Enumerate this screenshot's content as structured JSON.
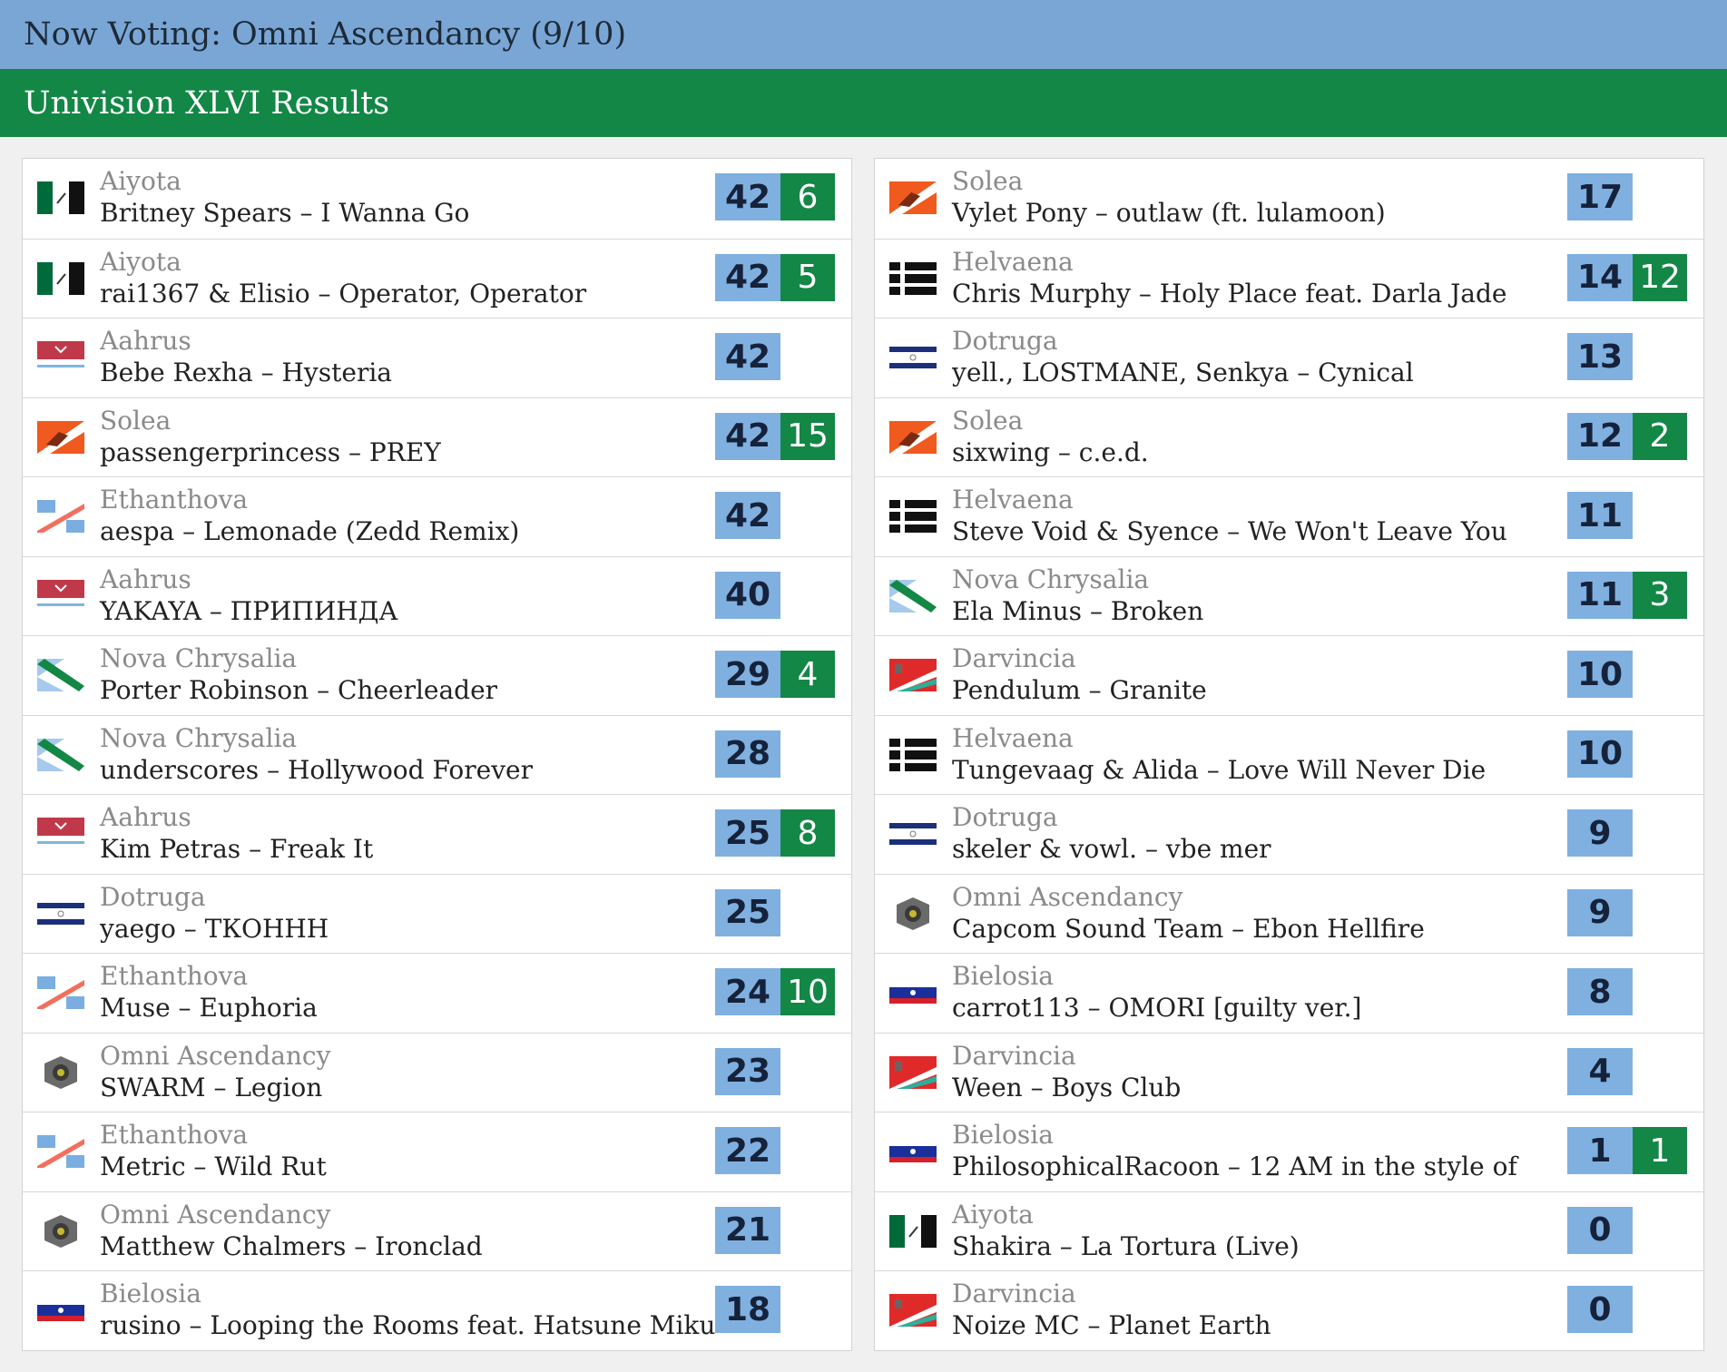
{
  "header": {
    "now_voting": "Now Voting: Omni Ascendancy (9/10)",
    "results_title": "Univision XLVI Results"
  },
  "flag_colors": {
    "aiyota": [
      "#006b3a",
      "#ffffff",
      "#111111"
    ],
    "aahrus": [
      "#c0394b",
      "#ffffff",
      "#7fb6e0"
    ],
    "solea": [
      "#f05a1e",
      "#ffffff",
      "#7a2a10"
    ],
    "ethanthova": [
      "#7aaee0",
      "#ffffff",
      "#f07060"
    ],
    "nova_chrysalia": [
      "#7fb4e6",
      "#ffffff",
      "#138746"
    ],
    "dotruga": [
      "#1b2f7a",
      "#ffffff"
    ],
    "omni_ascendancy": [
      "#6a6a6a",
      "#c8b830",
      "#3a3a3a"
    ],
    "bielosia": [
      "#ffffff",
      "#1a2f9a",
      "#d4202a"
    ],
    "helvaena": [
      "#111111",
      "#ffffff"
    ],
    "darvincia": [
      "#e02a2a",
      "#ffffff",
      "#2ab09a"
    ]
  },
  "results_left": [
    {
      "flag": "aiyota-flag-icon",
      "country": "Aiyota",
      "song": "Britney Spears – I Wanna Go",
      "points": "42",
      "jury": "6"
    },
    {
      "flag": "aiyota-flag-icon",
      "country": "Aiyota",
      "song": "rai1367 & Elisio – Operator, Operator",
      "points": "42",
      "jury": "5"
    },
    {
      "flag": "aahrus-flag-icon",
      "country": "Aahrus",
      "song": "Bebe Rexha – Hysteria",
      "points": "42",
      "jury": ""
    },
    {
      "flag": "solea-flag-icon",
      "country": "Solea",
      "song": "passengerprincess – PREY",
      "points": "42",
      "jury": "15"
    },
    {
      "flag": "ethanthova-flag-icon",
      "country": "Ethanthova",
      "song": "aespa – Lemonade (Zedd Remix)",
      "points": "42",
      "jury": ""
    },
    {
      "flag": "aahrus-flag-icon",
      "country": "Aahrus",
      "song": "YAKAYA – ПРИПИНДА",
      "points": "40",
      "jury": ""
    },
    {
      "flag": "nova-chrysalia-flag-icon",
      "country": "Nova Chrysalia",
      "song": "Porter Robinson – Cheerleader",
      "points": "29",
      "jury": "4"
    },
    {
      "flag": "nova-chrysalia-flag-icon",
      "country": "Nova Chrysalia",
      "song": "underscores – Hollywood Forever",
      "points": "28",
      "jury": ""
    },
    {
      "flag": "aahrus-flag-icon",
      "country": "Aahrus",
      "song": "Kim Petras – Freak It",
      "points": "25",
      "jury": "8"
    },
    {
      "flag": "dotruga-flag-icon",
      "country": "Dotruga",
      "song": "yaego – ТКОННН",
      "points": "25",
      "jury": ""
    },
    {
      "flag": "ethanthova-flag-icon",
      "country": "Ethanthova",
      "song": "Muse – Euphoria",
      "points": "24",
      "jury": "10"
    },
    {
      "flag": "omni-ascendancy-flag-icon",
      "country": "Omni Ascendancy",
      "song": "SWARM – Legion",
      "points": "23",
      "jury": ""
    },
    {
      "flag": "ethanthova-flag-icon",
      "country": "Ethanthova",
      "song": "Metric – Wild Rut",
      "points": "22",
      "jury": ""
    },
    {
      "flag": "omni-ascendancy-flag-icon",
      "country": "Omni Ascendancy",
      "song": "Matthew Chalmers – Ironclad",
      "points": "21",
      "jury": ""
    },
    {
      "flag": "bielosia-flag-icon",
      "country": "Bielosia",
      "song": "rusino – Looping the Rooms feat. Hatsune Miku",
      "points": "18",
      "jury": ""
    }
  ],
  "results_right": [
    {
      "flag": "solea-flag-icon",
      "country": "Solea",
      "song": "Vylet Pony – outlaw (ft. lulamoon)",
      "points": "17",
      "jury": ""
    },
    {
      "flag": "helvaena-flag-icon",
      "country": "Helvaena",
      "song": "Chris Murphy – Holy Place feat. Darla Jade",
      "points": "14",
      "jury": "12"
    },
    {
      "flag": "dotruga-flag-icon",
      "country": "Dotruga",
      "song": "yell., LOSTMANE, Senkya – Cynical",
      "points": "13",
      "jury": ""
    },
    {
      "flag": "solea-flag-icon",
      "country": "Solea",
      "song": "sixwing – c.e.d.",
      "points": "12",
      "jury": "2"
    },
    {
      "flag": "helvaena-flag-icon",
      "country": "Helvaena",
      "song": "Steve Void & Syence – We Won't Leave You",
      "points": "11",
      "jury": ""
    },
    {
      "flag": "nova-chrysalia-flag-icon",
      "country": "Nova Chrysalia",
      "song": "Ela Minus – Broken",
      "points": "11",
      "jury": "3"
    },
    {
      "flag": "darvincia-flag-icon",
      "country": "Darvincia",
      "song": "Pendulum – Granite",
      "points": "10",
      "jury": ""
    },
    {
      "flag": "helvaena-flag-icon",
      "country": "Helvaena",
      "song": "Tungevaag & Alida – Love Will Never Die",
      "points": "10",
      "jury": ""
    },
    {
      "flag": "dotruga-flag-icon",
      "country": "Dotruga",
      "song": "skeler & vowl. – vbe mer",
      "points": "9",
      "jury": ""
    },
    {
      "flag": "omni-ascendancy-flag-icon",
      "country": "Omni Ascendancy",
      "song": "Capcom Sound Team – Ebon Hellfire",
      "points": "9",
      "jury": ""
    },
    {
      "flag": "bielosia-flag-icon",
      "country": "Bielosia",
      "song": "carrot113 – OMORI [guilty ver.]",
      "points": "8",
      "jury": ""
    },
    {
      "flag": "darvincia-flag-icon",
      "country": "Darvincia",
      "song": "Ween – Boys Club",
      "points": "4",
      "jury": ""
    },
    {
      "flag": "bielosia-flag-icon",
      "country": "Bielosia",
      "song": "PhilosophicalRacoon – 12 AM in the style of",
      "points": "1",
      "jury": "1"
    },
    {
      "flag": "aiyota-flag-icon",
      "country": "Aiyota",
      "song": "Shakira – La Tortura (Live)",
      "points": "0",
      "jury": ""
    },
    {
      "flag": "darvincia-flag-icon",
      "country": "Darvincia",
      "song": "Noize MC – Planet Earth",
      "points": "0",
      "jury": ""
    }
  ]
}
